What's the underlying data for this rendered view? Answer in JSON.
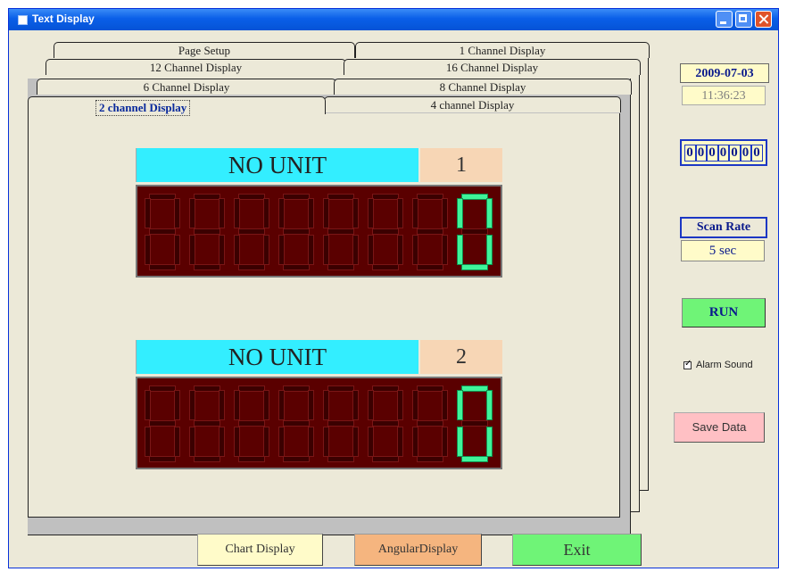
{
  "window": {
    "title": "Text Display"
  },
  "tabs": {
    "row1": [
      "Page Setup",
      "1 Channel Display"
    ],
    "row2": [
      "12 Channel Display",
      "16 Channel Display"
    ],
    "row3": [
      "6 Channel Display",
      "8 Channel Display"
    ],
    "row4": [
      "2 channel Display",
      "4 channel Display"
    ],
    "active": "2 channel Display"
  },
  "channels": [
    {
      "unit": "NO UNIT",
      "number": "1",
      "reading": "0"
    },
    {
      "unit": "NO UNIT",
      "number": "2",
      "reading": "0"
    }
  ],
  "sidebar": {
    "date": "2009-07-03",
    "time": "11:36:23",
    "counter": [
      "0",
      "0",
      "0",
      "0",
      "0",
      "0",
      "0"
    ],
    "scan_rate_title": "Scan Rate",
    "scan_rate_value": "5 sec",
    "run_label": "RUN",
    "alarm_label": "Alarm Sound",
    "alarm_checked": true,
    "save_label": "Save Data"
  },
  "bottom": {
    "chart_label": "Chart Display",
    "angular_label": "AngularDisplay",
    "exit_label": "Exit"
  },
  "colors": {
    "unit_bg": "#33eeff",
    "number_bg": "#f7d6b5",
    "display_bg": "#5a0000",
    "lit_segment": "#3ff49a"
  }
}
